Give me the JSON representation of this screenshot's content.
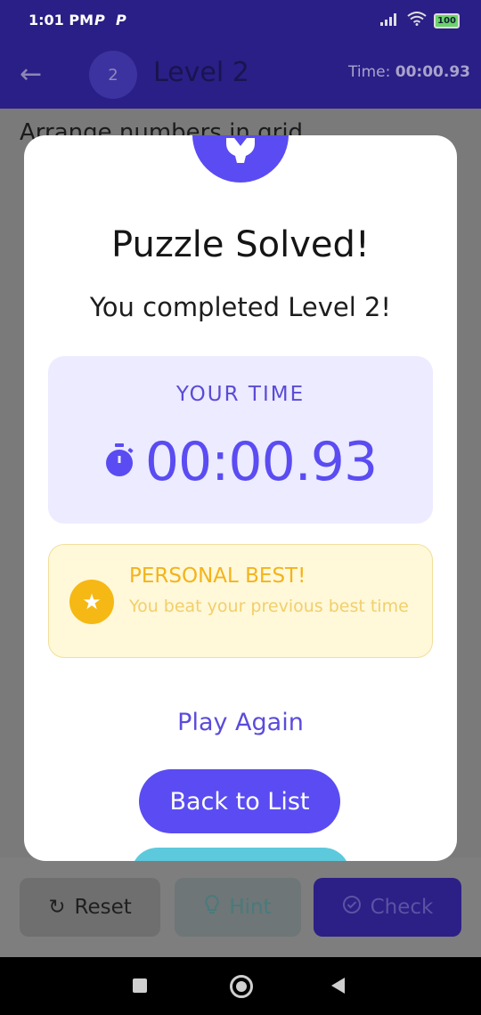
{
  "status_bar": {
    "time": "1:01 PM",
    "icon_letter_1": "P",
    "icon_letter_2": "P",
    "battery": "100"
  },
  "app_bar": {
    "level_number": "2",
    "title": "Level 2",
    "timer_label": "Time:",
    "timer_value": "00:00.93"
  },
  "instruction": "Arrange numbers in grid",
  "dialog": {
    "title": "Puzzle Solved!",
    "subtitle": "You completed Level 2!",
    "time_label": "YOUR TIME",
    "time_value": "00:00.93",
    "best_title": "PERSONAL BEST!",
    "best_desc": "You beat your previous best time",
    "play_again": "Play Again",
    "back_to_list": "Back to List"
  },
  "controls": {
    "reset": "Reset",
    "hint": "Hint",
    "check": "Check"
  },
  "colors": {
    "primary": "#5a4cf2",
    "appbar": "#2a1f86",
    "gold": "#f6b814",
    "teal": "#5dc9dc"
  }
}
